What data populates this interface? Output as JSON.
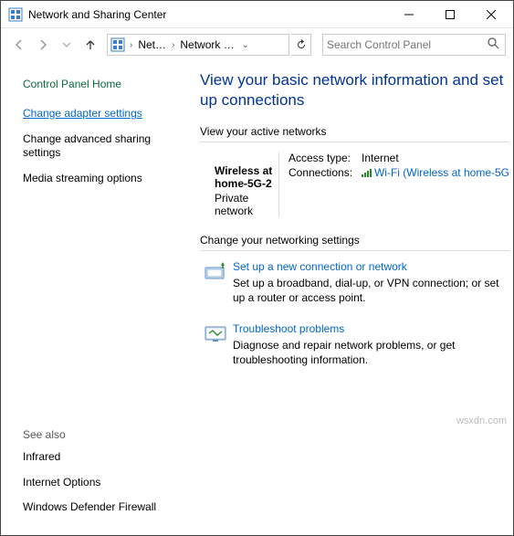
{
  "titlebar": {
    "title": "Network and Sharing Center"
  },
  "nav": {
    "crumb1": "Net…",
    "crumb2": "Network …",
    "search_placeholder": "Search Control Panel"
  },
  "sidebar": {
    "control_panel_home": "Control Panel Home",
    "change_adapter": "Change adapter settings",
    "change_advanced": "Change advanced sharing settings",
    "media_streaming": "Media streaming options",
    "see_also": "See also",
    "infrared": "Infrared",
    "internet_options": "Internet Options",
    "windows_firewall": "Windows Defender Firewall"
  },
  "main": {
    "headline": "View your basic network information and set up connections",
    "active_networks_label": "View your active networks",
    "network_name": "Wireless at home-5G-2",
    "network_type": "Private network",
    "access_type_label": "Access type:",
    "access_type_value": "Internet",
    "connections_label": "Connections:",
    "connections_value": "Wi-Fi (Wireless at home-5G",
    "change_settings_label": "Change your networking settings",
    "setup_title": "Set up a new connection or network",
    "setup_desc": "Set up a broadband, dial-up, or VPN connection; or set up a router or access point.",
    "troubleshoot_title": "Troubleshoot problems",
    "troubleshoot_desc": "Diagnose and repair network problems, or get troubleshooting information."
  },
  "watermark": "wsxdn.com"
}
